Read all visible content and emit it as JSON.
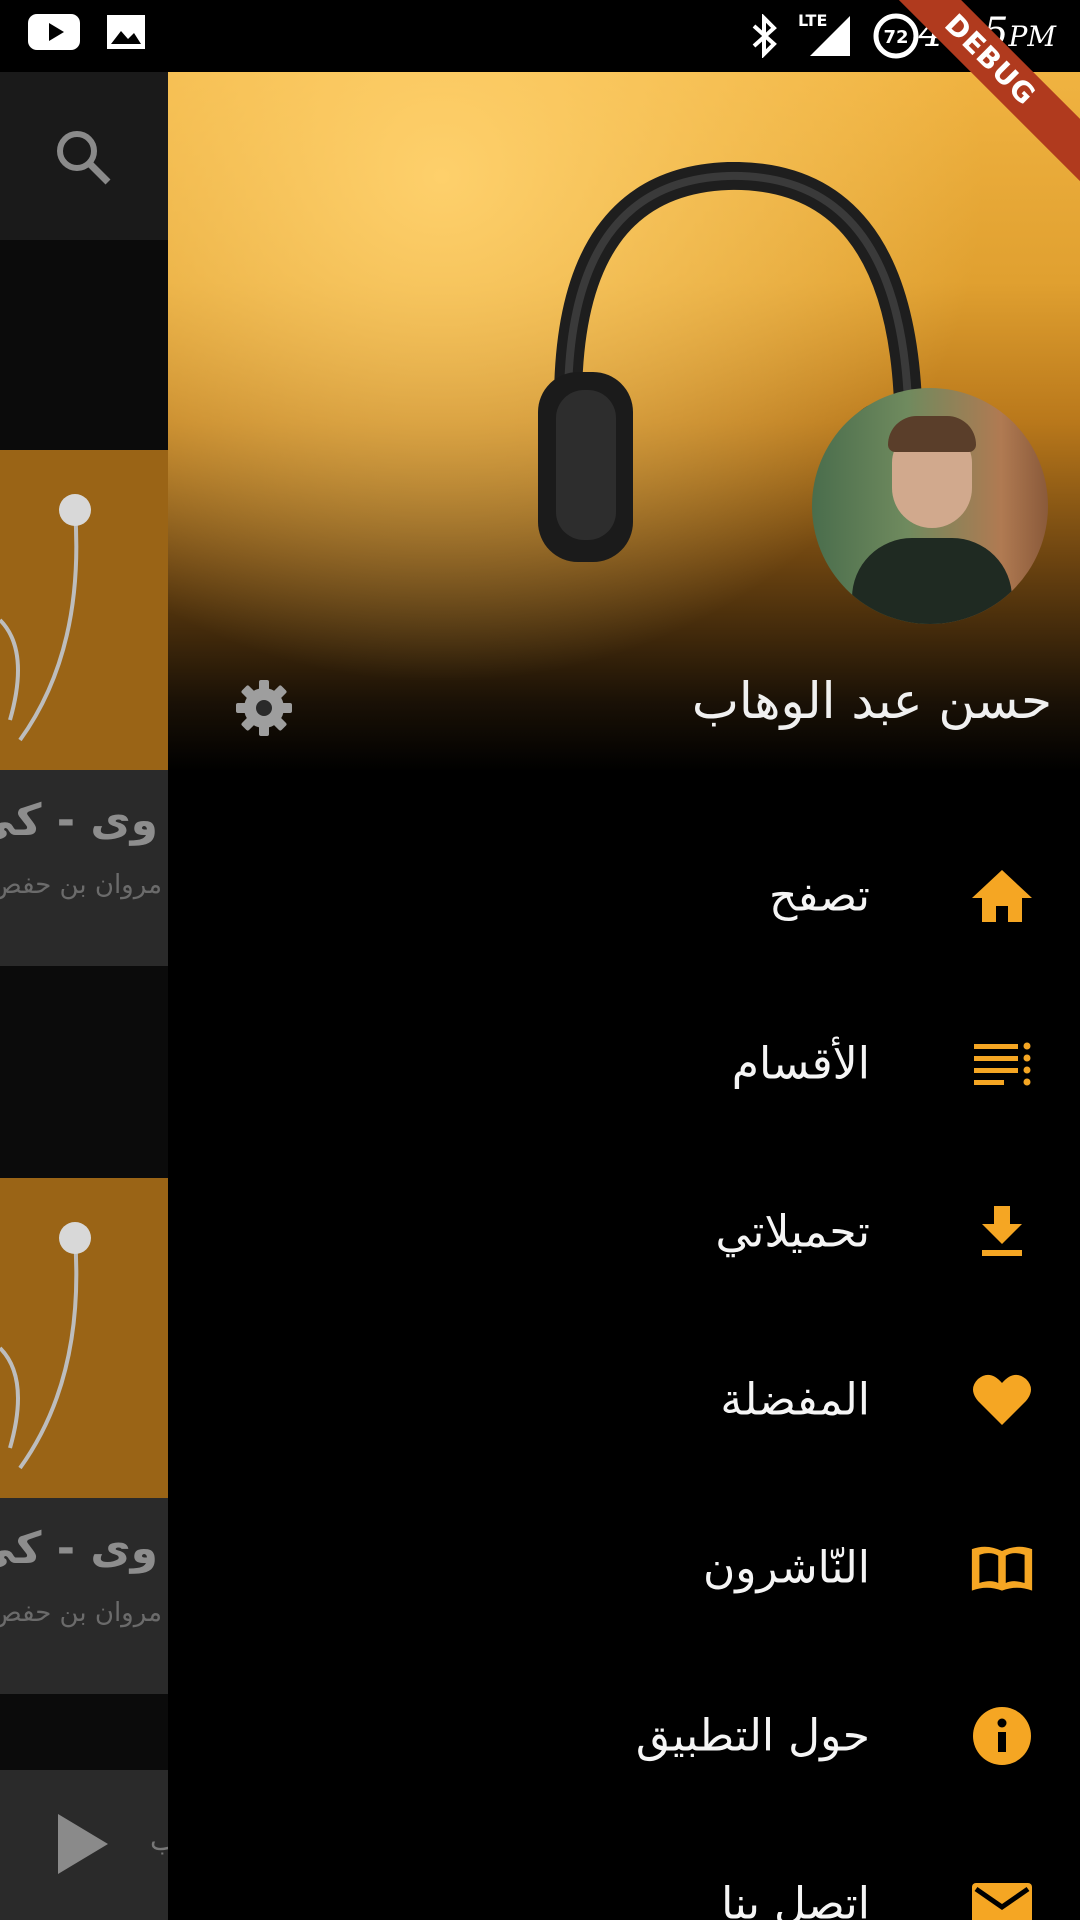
{
  "status_bar": {
    "time": "4:25",
    "ampm": "PM",
    "network": "LTE",
    "battery_level": "72",
    "debug_label": "DEBUG"
  },
  "background_app": {
    "cards": [
      {
        "title": "وى - كي",
        "subtitle": "مروان بن حفص"
      },
      {
        "title": "وى - كي",
        "subtitle": "مروان بن حفص"
      }
    ],
    "player_text": "ب"
  },
  "drawer": {
    "user_name": "حسن عبد الوهاب",
    "items": [
      {
        "label": "تصفح",
        "icon": "home-icon"
      },
      {
        "label": "الأقسام",
        "icon": "list-icon"
      },
      {
        "label": "تحميلاتي",
        "icon": "download-icon"
      },
      {
        "label": "المفضلة",
        "icon": "heart-icon"
      },
      {
        "label": "النّاشرون",
        "icon": "book-icon"
      },
      {
        "label": "حول التطبيق",
        "icon": "info-icon"
      },
      {
        "label": "اتصل بنا",
        "icon": "mail-icon"
      }
    ]
  },
  "colors": {
    "accent": "#F5A623",
    "background": "#000000",
    "text": "#F5F5F5"
  }
}
